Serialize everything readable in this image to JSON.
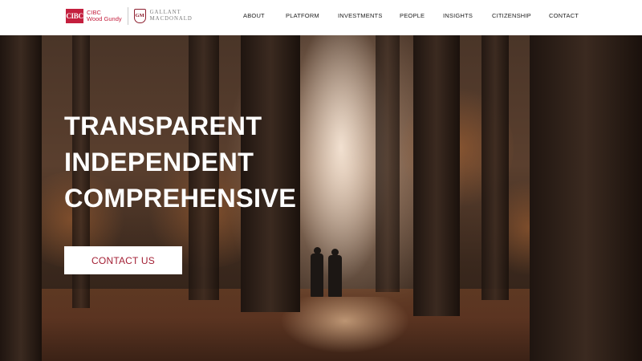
{
  "header": {
    "cibc_logo": {
      "mark": "CIBC",
      "line1": "CIBC",
      "line2": "Wood Gundy"
    },
    "gm_logo": {
      "seal": "GM",
      "line1": "GALLANT",
      "line2": "MACDONALD"
    },
    "nav": [
      {
        "label": "ABOUT"
      },
      {
        "label": "PLATFORM"
      },
      {
        "label": "INVESTMENTS"
      },
      {
        "label": "PEOPLE"
      },
      {
        "label": "INSIGHTS"
      },
      {
        "label": "CITIZENSHIP"
      },
      {
        "label": "CONTACT"
      }
    ]
  },
  "hero": {
    "headline": [
      "TRANSPARENT",
      "INDEPENDENT",
      "COMPREHENSIVE"
    ],
    "cta_label": "CONTACT US"
  },
  "colors": {
    "brand_red": "#c41f3e",
    "cta_text": "#a31f34",
    "header_bg": "#ffffff"
  }
}
